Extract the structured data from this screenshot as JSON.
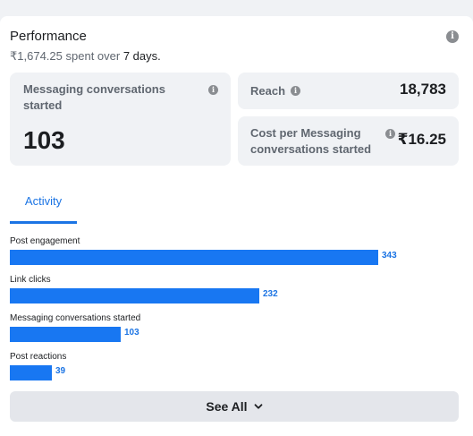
{
  "performance": {
    "title": "Performance",
    "spend": "₹1,674.25",
    "spent_over": "spent over",
    "period": "7 days."
  },
  "metrics": {
    "messaging": {
      "label": "Messaging conversations started",
      "value": "103"
    },
    "reach": {
      "label": "Reach",
      "value": "18,783"
    },
    "cost": {
      "label": "Cost per Messaging conversations started",
      "value": "₹16.25"
    }
  },
  "tabs": [
    {
      "label": "Activity",
      "active": true
    }
  ],
  "activity": {
    "max_value": 343,
    "rows": [
      {
        "label": "Post engagement",
        "value": 343
      },
      {
        "label": "Link clicks",
        "value": 232
      },
      {
        "label": "Messaging conversations started",
        "value": 103
      },
      {
        "label": "Post reactions",
        "value": 39
      }
    ]
  },
  "see_all": {
    "label": "See All"
  },
  "colors": {
    "accent": "#1b74e4",
    "bar": "#1877f2",
    "panel": "#f0f2f5",
    "button": "#e4e6eb"
  },
  "icons": {
    "info": "info-icon",
    "chevron": "chevron-down-icon"
  }
}
